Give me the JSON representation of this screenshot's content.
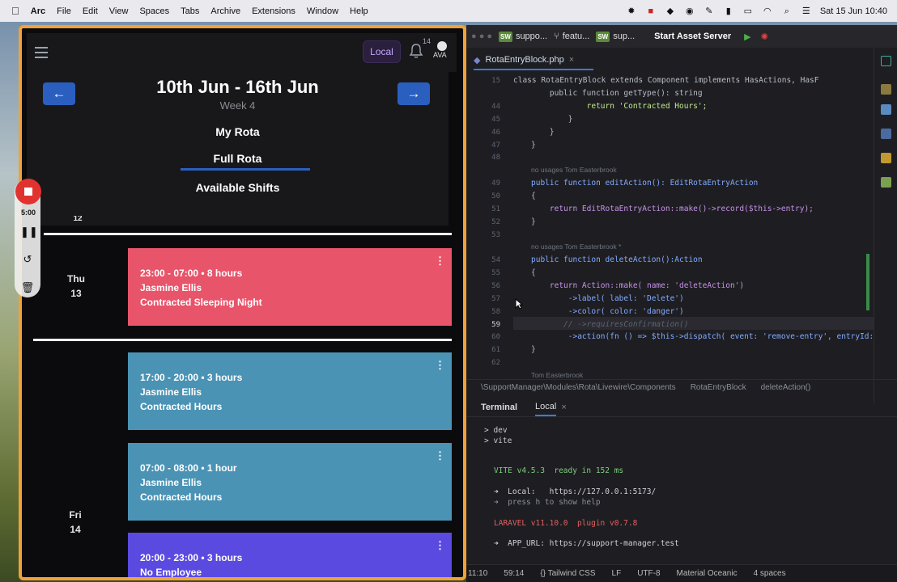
{
  "menubar": {
    "app_name": "Arc",
    "menus": [
      "File",
      "Edit",
      "View",
      "Spaces",
      "Tabs",
      "Archive",
      "Extensions",
      "Window",
      "Help"
    ],
    "clock": "Sat 15 Jun 10:40"
  },
  "arc": {
    "local_badge": "Local",
    "notification_count": "14",
    "avatar_text": "AVA",
    "date_range": "10th Jun - 16th Jun",
    "week_label": "Week 4",
    "tabs": [
      "My Rota",
      "Full Rota",
      "Available Shifts"
    ],
    "active_tab": "Full Rota",
    "prev_arrow": "←",
    "next_arrow": "→",
    "recording": {
      "time": "5:00"
    },
    "partial_day": "12",
    "days": [
      {
        "name": "Thu",
        "num": "13"
      },
      {
        "name": "Fri",
        "num": "14"
      }
    ],
    "shifts": [
      {
        "time": "23:00 - 07:00 • 8 hours",
        "employee": "Jasmine Ellis",
        "type": "Contracted Sleeping Night",
        "color": "#e8546a"
      },
      {
        "time": "17:00 - 20:00 • 3 hours",
        "employee": "Jasmine Ellis",
        "type": "Contracted Hours",
        "color": "#4a93b5"
      },
      {
        "time": "07:00 - 08:00 • 1 hour",
        "employee": "Jasmine Ellis",
        "type": "Contracted Hours",
        "color": "#4a93b5"
      },
      {
        "time": "20:00 - 23:00 • 3 hours",
        "employee": "No Employee",
        "type": "",
        "color": "#5b4ae0"
      }
    ]
  },
  "editor": {
    "tabs": [
      {
        "badge": "SW",
        "label": "suppo..."
      },
      {
        "badge": "",
        "label": "featu..."
      },
      {
        "badge": "SW",
        "label": "sup..."
      }
    ],
    "start_asset_server": "Start Asset Server",
    "file_tab": "RotaEntryBlock.php",
    "code_lines": [
      {
        "ln": "15",
        "html": "class RotaEntryBlock extends Component implements HasActions, HasF"
      },
      {
        "ln": "",
        "html": "    public function getType(): string"
      },
      {
        "ln": "44",
        "html": "            return 'Contracted Hours';"
      },
      {
        "ln": "45",
        "html": "        }"
      },
      {
        "ln": "46",
        "html": "    }"
      },
      {
        "ln": "47",
        "html": "}"
      },
      {
        "ln": "48",
        "html": ""
      },
      {
        "ln": "",
        "html": "no usages   Tom Easterbrook"
      },
      {
        "ln": "49",
        "html": "public function editAction(): EditRotaEntryAction"
      },
      {
        "ln": "50",
        "html": "{"
      },
      {
        "ln": "51",
        "html": "    return EditRotaEntryAction::make()->record($this->entry);"
      },
      {
        "ln": "52",
        "html": "}"
      },
      {
        "ln": "53",
        "html": ""
      },
      {
        "ln": "",
        "html": "no usages   Tom Easterbrook *"
      },
      {
        "ln": "54",
        "html": "public function deleteAction():Action"
      },
      {
        "ln": "55",
        "html": "{"
      },
      {
        "ln": "56",
        "html": "    return Action::make( name: 'deleteAction')"
      },
      {
        "ln": "57",
        "html": "        ->label( label: 'Delete')"
      },
      {
        "ln": "58",
        "html": "        ->color( color: 'danger')"
      },
      {
        "ln": "59",
        "html": "       // ->requiresConfirmation()"
      },
      {
        "ln": "60",
        "html": "        ->action(fn () => $this->dispatch( event: 'remove-entry', entryId: $th"
      },
      {
        "ln": "61",
        "html": "}"
      },
      {
        "ln": "62",
        "html": ""
      },
      {
        "ln": "",
        "html": "Tom Easterbrook"
      }
    ],
    "breadcrumb": [
      "\\SupportManager\\Modules\\Rota\\Livewire\\Components",
      "RotaEntryBlock",
      "deleteAction()"
    ],
    "terminal": {
      "title": "Terminal",
      "tab": "Local",
      "lines": [
        "> dev",
        "> vite",
        "VITE v4.5.3  ready in 152 ms",
        "➜  Local:   https://127.0.0.1:5173/",
        "➜  press h to show help",
        "LARAVEL v11.10.0  plugin v0.7.8",
        "➜  APP_URL: https://support-manager.test"
      ]
    },
    "status": [
      "11:10",
      "59:14",
      "{} Tailwind CSS",
      "LF",
      "UTF-8",
      "Material Oceanic",
      "4 spaces"
    ]
  }
}
